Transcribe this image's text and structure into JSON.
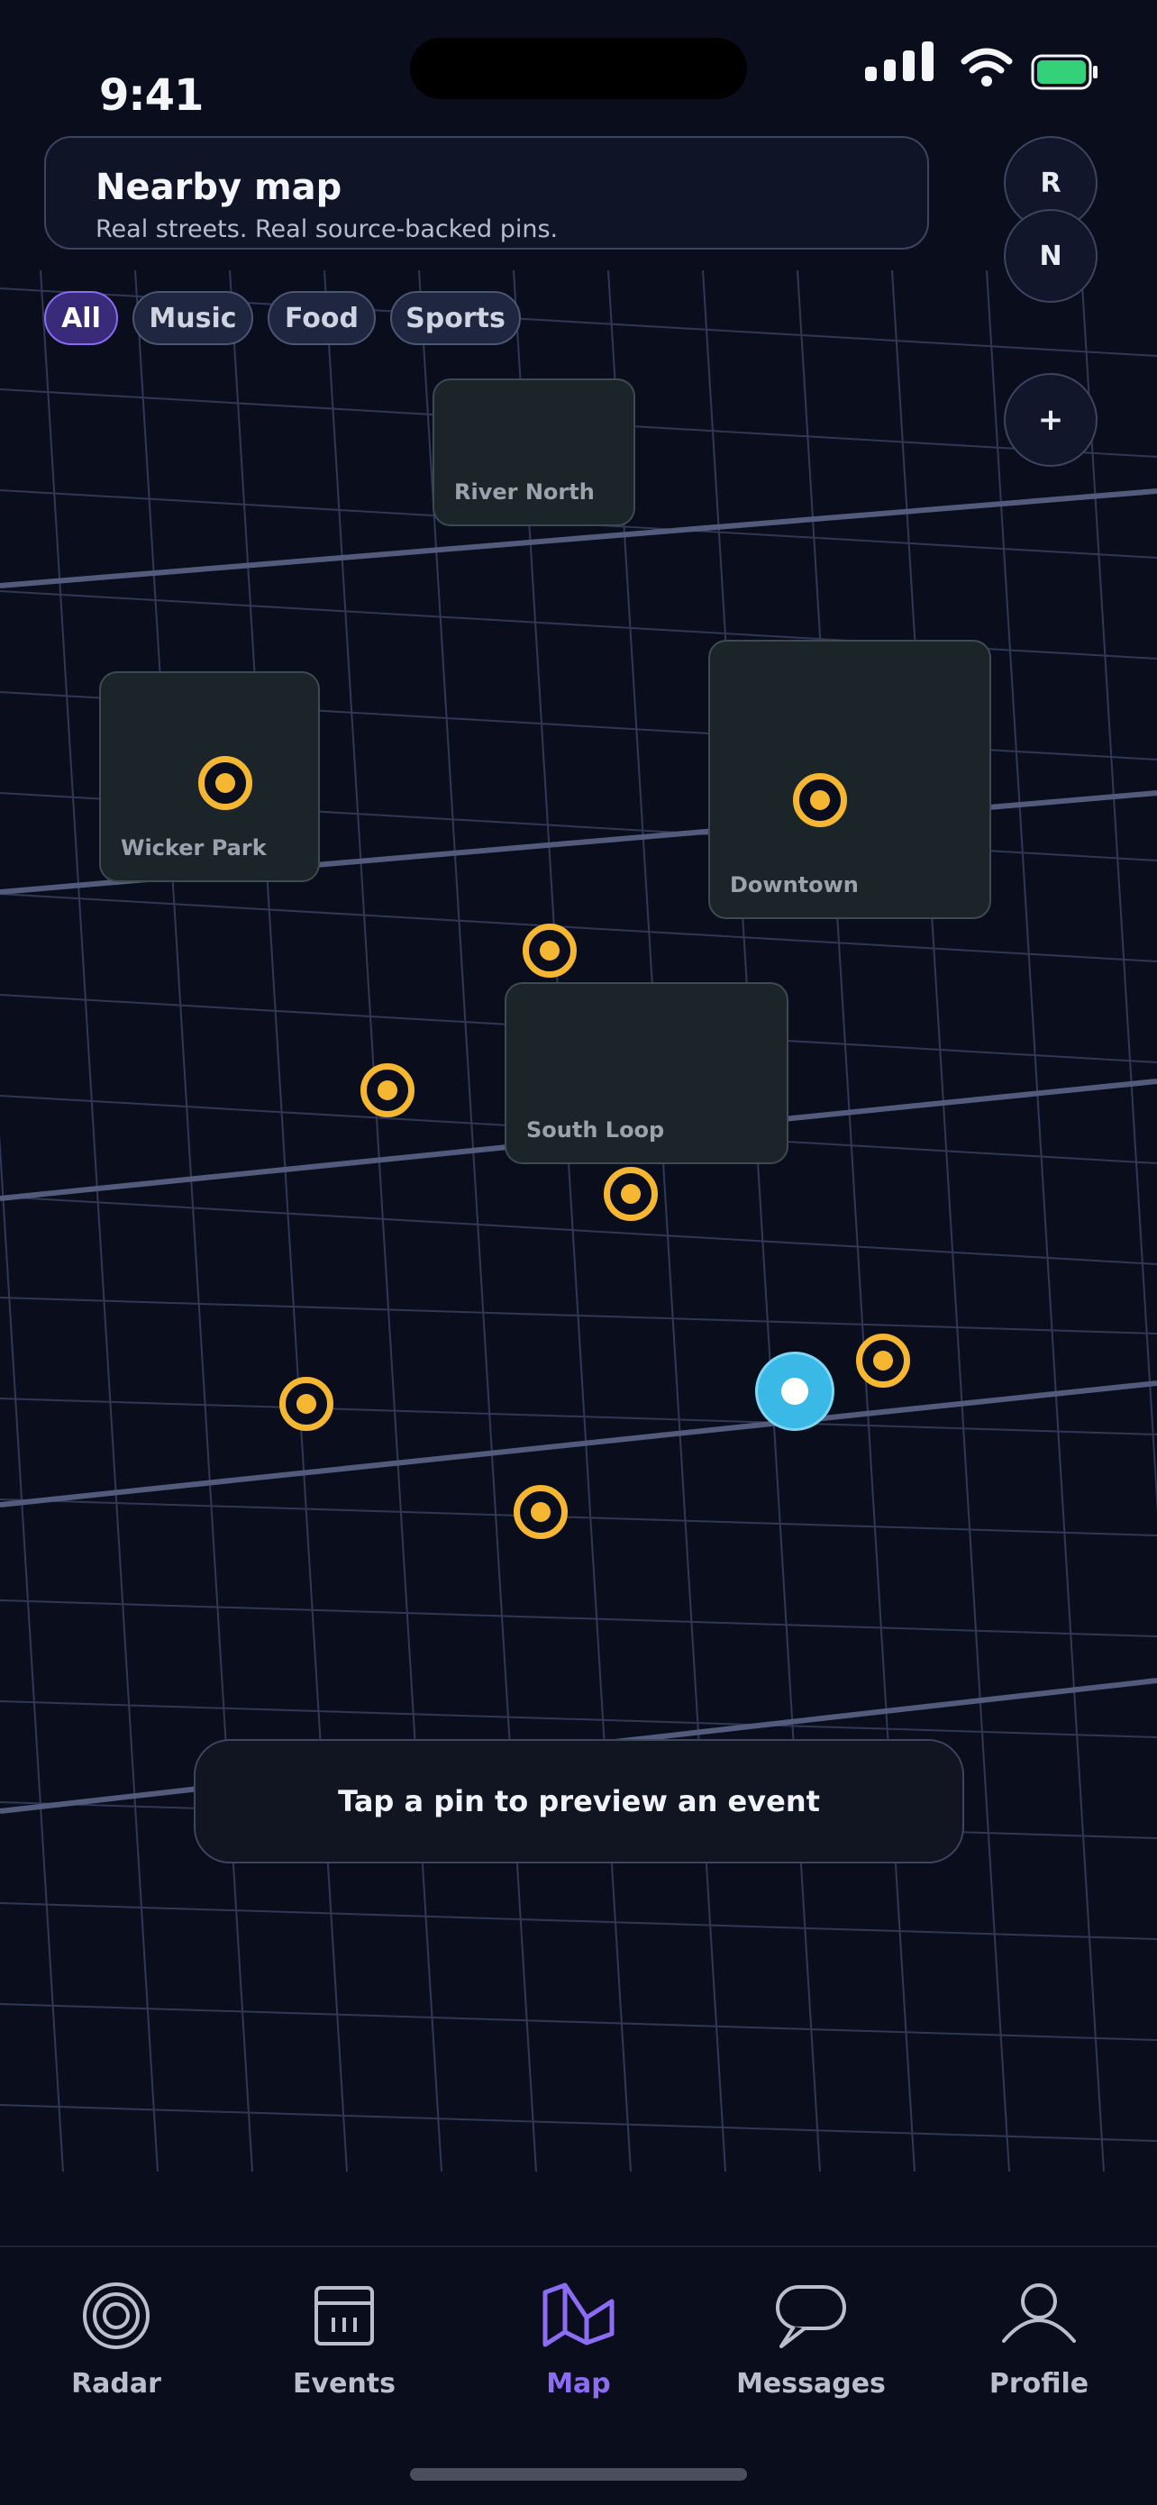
{
  "status_bar": {
    "time": "9:41"
  },
  "header": {
    "title": "Nearby map",
    "subtitle": "Real streets. Real source-backed pins."
  },
  "map_controls": {
    "recenter_label": "R",
    "north_label": "N",
    "zoom_in_label": "+"
  },
  "filters": [
    {
      "label": "All",
      "active": true
    },
    {
      "label": "Music",
      "active": false
    },
    {
      "label": "Food",
      "active": false
    },
    {
      "label": "Sports",
      "active": false
    }
  ],
  "neighborhoods": [
    "River North",
    "Wicker Park",
    "Downtown",
    "South Loop"
  ],
  "hint": "Tap a pin to preview an event",
  "nav": [
    {
      "label": "Radar",
      "icon": "radar-icon",
      "active": false
    },
    {
      "label": "Events",
      "icon": "calendar-icon",
      "active": false
    },
    {
      "label": "Map",
      "icon": "map-icon",
      "active": true
    },
    {
      "label": "Messages",
      "icon": "chat-bubble-icon",
      "active": false
    },
    {
      "label": "Profile",
      "icon": "person-icon",
      "active": false
    }
  ],
  "colors": {
    "background": "#0a0e1c",
    "accent": "#8d6cf4",
    "pin": "#f5b731",
    "user_location": "#3ab9e6",
    "street": "#525b7c"
  }
}
